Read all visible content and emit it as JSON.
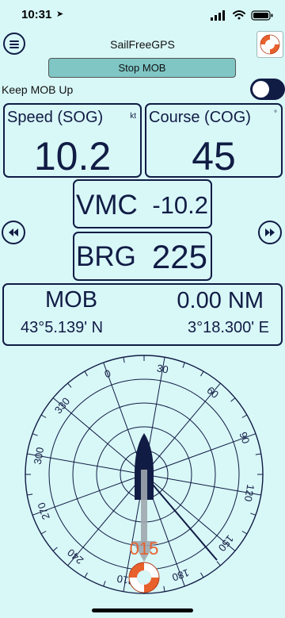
{
  "status": {
    "time": "10:31"
  },
  "header": {
    "title": "SailFreeGPS",
    "stop_button": "Stop MOB"
  },
  "keep_mob": {
    "label": "Keep MOB Up"
  },
  "speed": {
    "label": "Speed (SOG)",
    "unit": "kt",
    "value": "10.2"
  },
  "course": {
    "label": "Course (COG)",
    "unit": "°",
    "value": "45"
  },
  "vmc": {
    "label": "VMC",
    "value": "-10.2"
  },
  "brg": {
    "label": "BRG",
    "value": "225"
  },
  "mob": {
    "label": "MOB",
    "distance": "0.00 NM",
    "lat": "43°5.139' N",
    "lon": "3°18.300' E"
  },
  "compass": {
    "heading_labels": [
      "0",
      "30",
      "60",
      "90",
      "120",
      "150",
      "180",
      "210",
      "240",
      "270",
      "300",
      "330"
    ],
    "mob_marker_label": "015"
  },
  "colors": {
    "background": "#d8f7f7",
    "primary": "#111c45",
    "accent": "#e8602c",
    "button": "#7fc6c5"
  }
}
